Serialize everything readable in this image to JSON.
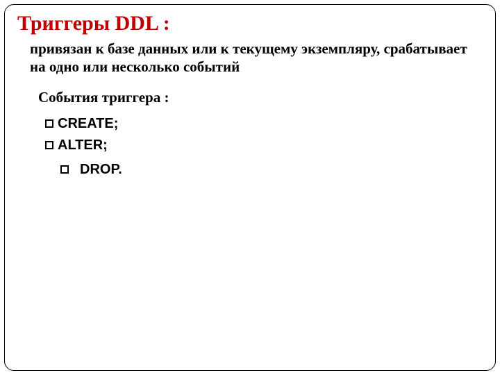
{
  "title": "Триггеры DDL :",
  "description": "привязан к базе данных или к текущему экземпляру, срабатывает на одно или несколько событий",
  "subtitle": "События триггера :",
  "items": [
    {
      "label": "CREATE;"
    },
    {
      "label": "ALTER;"
    },
    {
      "label": "DROP."
    }
  ]
}
